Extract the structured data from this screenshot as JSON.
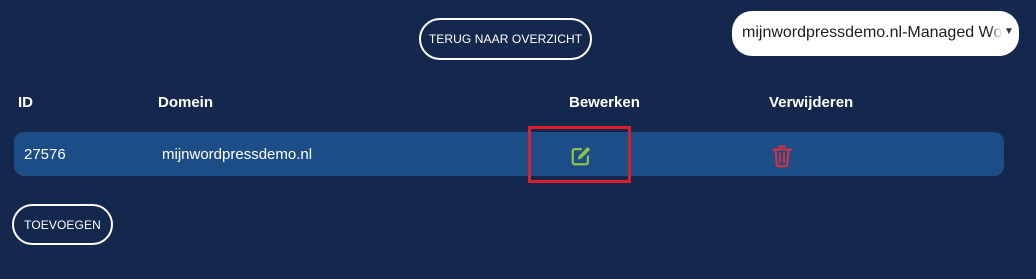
{
  "header": {
    "back_button_label": "TERUG NAAR OVERZICHT",
    "domain_select": {
      "selected": "mijnwordpressdemo.nl-Managed Wordpress"
    }
  },
  "table": {
    "columns": {
      "id": "ID",
      "domain": "Domein",
      "edit": "Bewerken",
      "delete": "Verwijderen"
    },
    "rows": [
      {
        "id": "27576",
        "domain": "mijnwordpressdemo.nl"
      }
    ]
  },
  "footer": {
    "add_button_label": "TOEVOEGEN"
  },
  "icons": {
    "edit": "edit-icon",
    "delete": "trash-icon"
  },
  "colors": {
    "background": "#13284c",
    "row": "#1d4d86",
    "edit_icon": "#8bc34a",
    "delete_icon": "#e0303c",
    "highlight": "#d9202c"
  }
}
